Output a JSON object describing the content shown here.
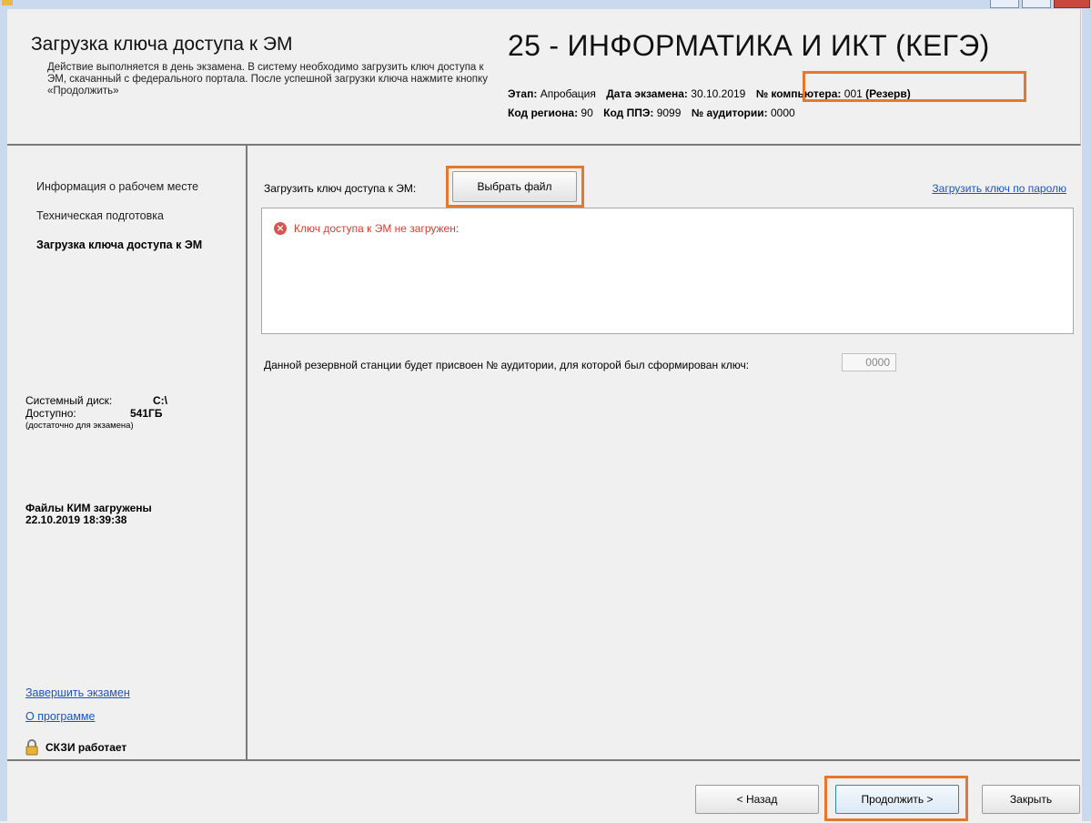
{
  "header": {
    "page_title": "Загрузка ключа доступа к ЭМ",
    "description": "Действие выполняется в день экзамена. В систему необходимо загрузить ключ доступа к ЭМ, скачанный с федерального портала. После успешной загрузки ключа нажмите кнопку «Продолжить»",
    "exam_title": "25 - ИНФОРМАТИКА И ИКТ (КЕГЭ)",
    "stage_label": "Этап:",
    "stage_value": "Апробация",
    "date_label": "Дата экзамена:",
    "date_value": "30.10.2019",
    "computer_label": "№ компьютера:",
    "computer_value": "001",
    "computer_reserve": "(Резерв)",
    "region_label": "Код региона:",
    "region_value": "90",
    "ppe_label": "Код ППЭ:",
    "ppe_value": "9099",
    "auditorium_label": "№ аудитории:",
    "auditorium_value": "0000"
  },
  "sidebar": {
    "items": [
      {
        "label": "Информация о рабочем месте"
      },
      {
        "label": "Техническая подготовка"
      },
      {
        "label": "Загрузка ключа доступа к ЭМ"
      }
    ],
    "system_disk_label": "Системный диск:",
    "system_disk_value": "C:\\",
    "available_label": "Доступно:",
    "available_value": "541ГБ",
    "available_note": "(достаточно для экзамена)",
    "kim_line1": "Файлы КИМ загружены",
    "kim_line2": "22.10.2019 18:39:38",
    "finish_link": "Завершить экзамен",
    "about_link": "О программе",
    "skzi_status": "СКЗИ работает"
  },
  "main": {
    "upload_label": "Загрузить ключ доступа к ЭМ:",
    "choose_file_button": "Выбрать файл",
    "password_link": "Загрузить ключ по паролю",
    "error_text": "Ключ доступа к ЭМ не загружен:",
    "reserve_text": "Данной резервной станции будет присвоен № аудитории, для которой был сформирован ключ:",
    "auditorium_field_value": "0000"
  },
  "footer": {
    "back_button": "< Назад",
    "next_button": "Продолжить >",
    "close_button": "Закрыть"
  },
  "colors": {
    "highlight": "#e6782e",
    "link": "#1a55c8",
    "error": "#e03a2f"
  }
}
